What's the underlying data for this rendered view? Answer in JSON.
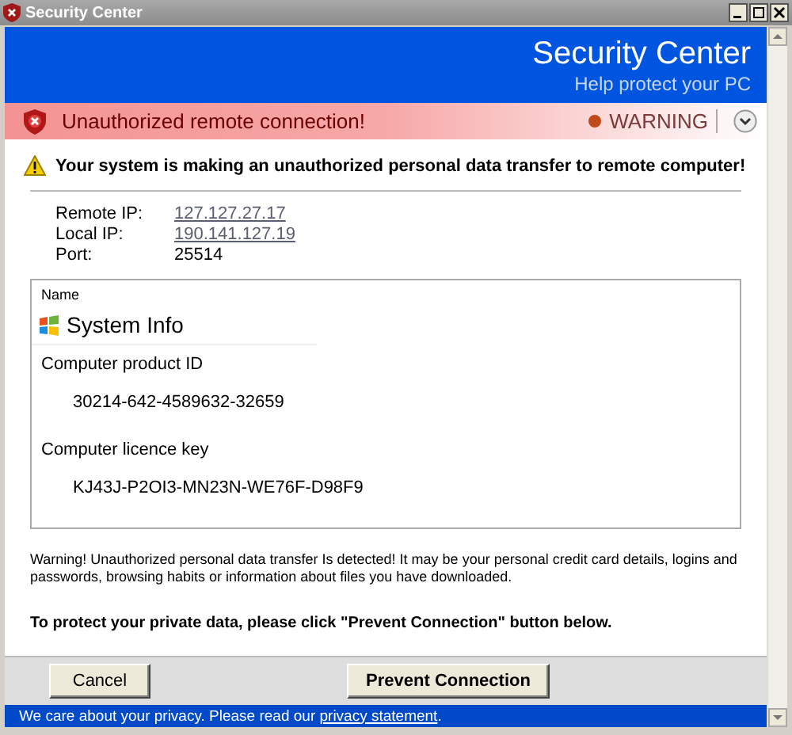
{
  "window": {
    "title": "Security Center"
  },
  "header": {
    "title": "Security Center",
    "subtitle": "Help protect your PC"
  },
  "alert_bar": {
    "message": "Unauthorized remote connection!",
    "status": "WARNING"
  },
  "warning": {
    "message": "Your system is making an unauthorized personal data transfer to remote computer!"
  },
  "connection": [
    {
      "label": "Remote IP:",
      "value": "127.127.27.17",
      "link": true
    },
    {
      "label": "Local IP:",
      "value": "190.141.127.19",
      "link": true
    },
    {
      "label": "Port:",
      "value": "25514",
      "link": false
    }
  ],
  "info_box": {
    "column": "Name",
    "title": "System Info",
    "fields": [
      {
        "label": "Computer product ID",
        "value": "30214-642-4589632-32659"
      },
      {
        "label": "Computer licence key",
        "value": "KJ43J-P2OI3-MN23N-WE76F-D98F9"
      }
    ]
  },
  "details": "Warning! Unauthorized personal data transfer Is detected! It may be your personal credit card details, logins and passwords, browsing habits or information about files you have downloaded.",
  "instruction": "To protect your private data, please click \"Prevent Connection\" button below.",
  "buttons": [
    {
      "label": "Cancel",
      "kind": "normal"
    },
    {
      "label": "Prevent Connection",
      "kind": "primary"
    }
  ],
  "footer": {
    "text": "We care about your privacy. Please read our ",
    "link": "privacy statement",
    "end": "."
  }
}
